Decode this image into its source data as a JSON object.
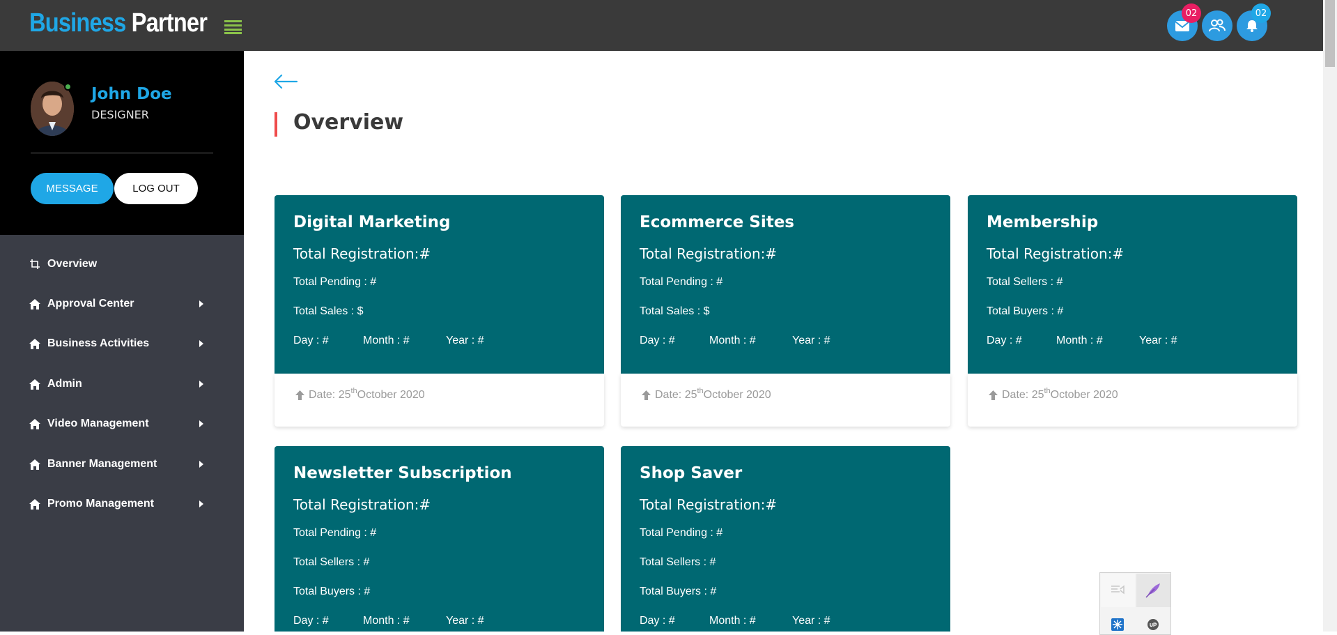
{
  "header": {
    "logo_part1": "Business",
    "logo_part2": "Partner",
    "notifications": [
      {
        "name": "mail",
        "icon": "envelope-icon",
        "badge": "02",
        "badge_color": "#e91e63"
      },
      {
        "name": "users",
        "icon": "users-icon",
        "badge": "",
        "badge_color": ""
      },
      {
        "name": "bell",
        "icon": "bell-icon",
        "badge": "02",
        "badge_color": "#1fa7e6"
      }
    ]
  },
  "profile": {
    "name": "John Doe",
    "role": "DESIGNER",
    "message_label": "MESSAGE",
    "logout_label": "LOG OUT"
  },
  "sidebar": {
    "items": [
      {
        "label": "Overview",
        "icon": "crop-icon",
        "has_caret": false
      },
      {
        "label": "Approval Center",
        "icon": "home-icon",
        "has_caret": true
      },
      {
        "label": "Business Activities",
        "icon": "home-icon",
        "has_caret": true
      },
      {
        "label": "Admin",
        "icon": "home-icon",
        "has_caret": true
      },
      {
        "label": "Video Management",
        "icon": "home-icon",
        "has_caret": true
      },
      {
        "label": "Banner Management",
        "icon": "home-icon",
        "has_caret": true
      },
      {
        "label": "Promo Management",
        "icon": "home-icon",
        "has_caret": true
      }
    ]
  },
  "main": {
    "page_title": "Overview",
    "cards": [
      {
        "title": "Digital Marketing",
        "registration": "Total Registration:#",
        "lines": [
          "Total Pending : #",
          "Total Sales : $"
        ],
        "day": "Day : #",
        "month": "Month : #",
        "year": "Year : #",
        "date_prefix": "Date: 25",
        "date_sup": "th",
        "date_suffix": " October 2020"
      },
      {
        "title": "Ecommerce Sites",
        "registration": "Total Registration:#",
        "lines": [
          "Total Pending : #",
          "Total Sales : $"
        ],
        "day": "Day : #",
        "month": "Month : #",
        "year": "Year : #",
        "date_prefix": "Date: 25",
        "date_sup": "th",
        "date_suffix": " October 2020"
      },
      {
        "title": "Membership",
        "registration": "Total Registration:#",
        "lines": [
          "Total Sellers : #",
          "Total Buyers : #"
        ],
        "day": "Day : #",
        "month": "Month : #",
        "year": "Year : #",
        "date_prefix": "Date: 25",
        "date_sup": "th",
        "date_suffix": " October 2020"
      },
      {
        "title": "Newsletter Subscription",
        "registration": "Total Registration:#",
        "lines": [
          "Total Pending : #",
          "Total Sellers : #",
          "Total Buyers : #"
        ],
        "day": "Day : #",
        "month": "Month : #",
        "year": "Year : #"
      },
      {
        "title": "Shop Saver",
        "registration": "Total Registration:#",
        "lines": [
          "Total Pending : #",
          "Total Sellers : #",
          "Total Buyers : #"
        ],
        "day": "Day : #",
        "month": "Month : #",
        "year": "Year : #"
      }
    ]
  },
  "colors": {
    "topbar": "#3a3a3a",
    "sidebar_top": "#000000",
    "sidebar_nav": "#3a3d46",
    "accent_blue": "#1fa7e6",
    "card_teal": "#006872",
    "title_accent": "#ef4b4b"
  }
}
